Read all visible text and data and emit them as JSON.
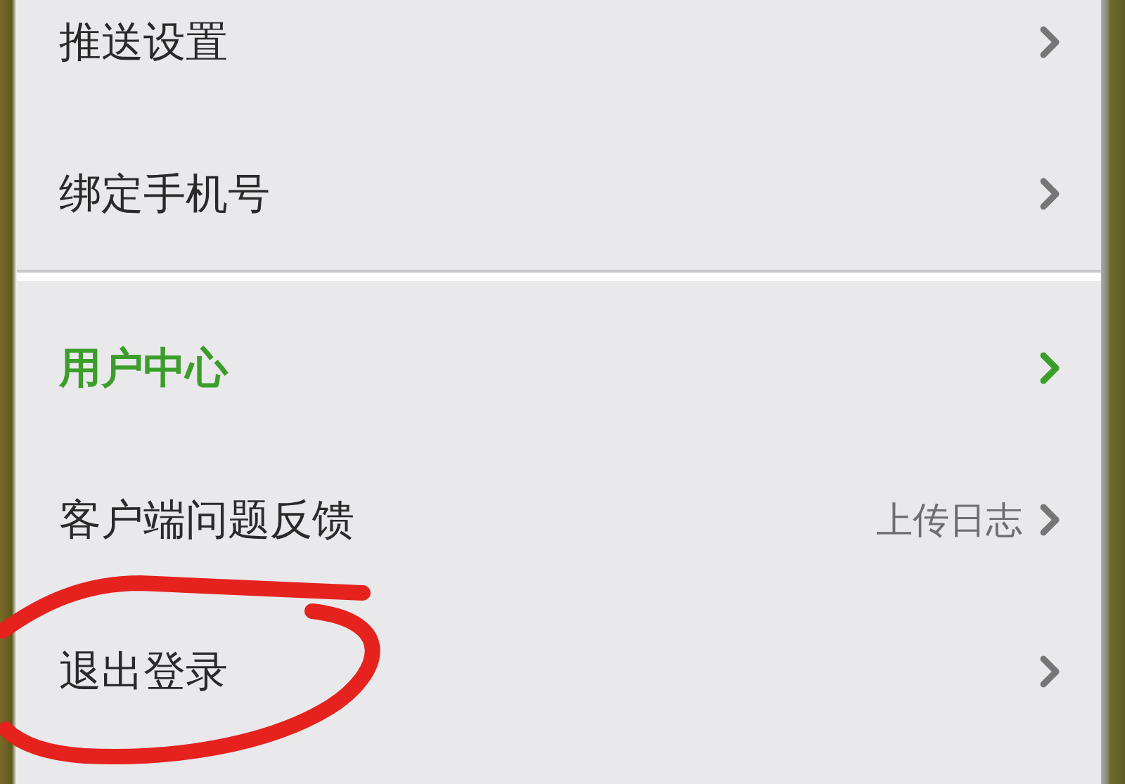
{
  "sections": [
    {
      "items": [
        {
          "label": "推送设置",
          "highlighted": false,
          "circled": false
        },
        {
          "label": "绑定手机号",
          "highlighted": false,
          "circled": false
        }
      ]
    },
    {
      "items": [
        {
          "label": "用户中心",
          "highlighted": true,
          "circled": false
        },
        {
          "label": "客户端问题反馈",
          "value": "上传日志",
          "highlighted": false,
          "circled": false
        },
        {
          "label": "退出登录",
          "highlighted": false,
          "circled": true
        }
      ]
    }
  ]
}
